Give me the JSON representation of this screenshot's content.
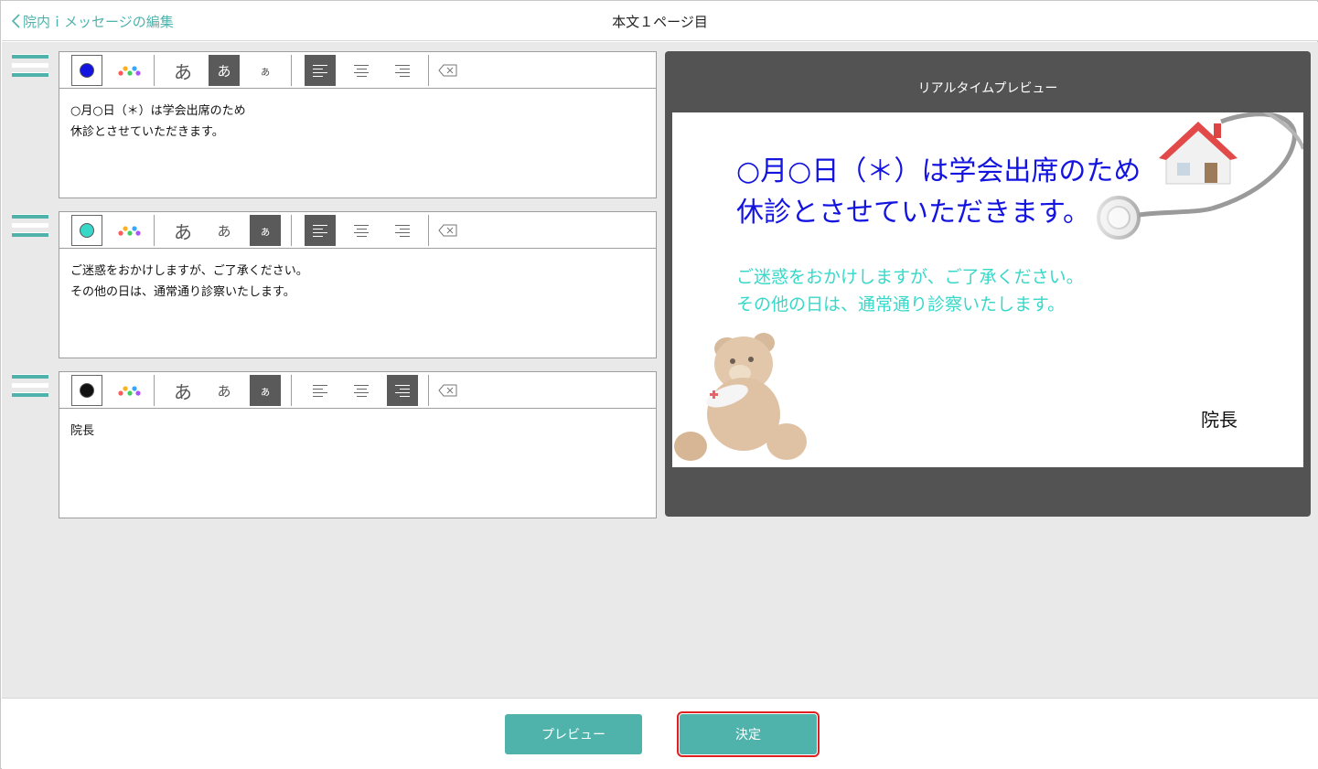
{
  "header": {
    "back_label": "院内ｉメッセージの編集",
    "title": "本文１ページ目"
  },
  "editor_blocks": [
    {
      "text": "○月○日（＊）は学会出席のため\n休診とさせていただきます。",
      "text_color": "#1414e0",
      "size_selected": "medium",
      "align_selected": "left"
    },
    {
      "text": "ご迷惑をおかけしますが、ご了承ください。\nその他の日は、通常通り診察いたします。",
      "text_color": "#38d8c9",
      "size_selected": "small",
      "align_selected": "left"
    },
    {
      "text": "院長",
      "text_color": "#111111",
      "size_selected": "small",
      "align_selected": "right"
    }
  ],
  "toolbar": {
    "size_large": "あ",
    "size_medium": "あ",
    "size_small": "ぁ"
  },
  "preview": {
    "label": "リアルタイムプレビュー",
    "line1": "○月○日（＊）は学会出席のため\n休診とさせていただきます。",
    "line2": "ご迷惑をおかけしますが、ご了承ください。\nその他の日は、通常通り診察いたします。",
    "line3": "院長"
  },
  "footer": {
    "preview_button": "プレビュー",
    "ok_button": "決定"
  },
  "colors": {
    "accent": "#4fb3ac",
    "active_tool": "#5a5a5a",
    "preview_panel": "#535353",
    "highlight": "#e02020"
  }
}
